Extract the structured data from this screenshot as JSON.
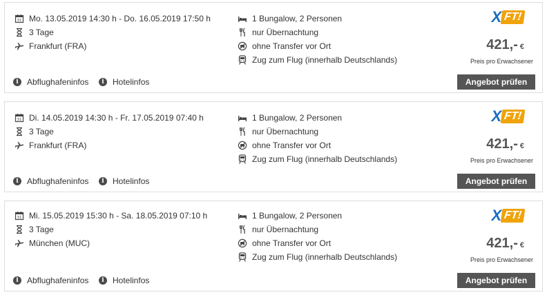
{
  "brand": {
    "logo_letter": "X",
    "logo_box": "FT!",
    "logo_x_color": "#1a6fc0",
    "logo_box_color": "#f0a30a"
  },
  "offers": [
    {
      "dates": "Mo. 13.05.2019 14:30 h - Do. 16.05.2019 17:50 h",
      "duration": "3 Tage",
      "airport": "Frankfurt (FRA)",
      "room": "1 Bungalow, 2 Personen",
      "board": "nur Übernachtung",
      "transfer": "ohne Transfer vor Ort",
      "train": "Zug zum Flug (innerhalb Deutschlands)",
      "price": "421,-",
      "currency": "€",
      "price_note": "Preis pro Erwachsener",
      "airport_info": "Abflughafeninfos",
      "hotel_info": "Hotelinfos",
      "cta": "Angebot prüfen"
    },
    {
      "dates": "Di. 14.05.2019 14:30 h - Fr. 17.05.2019 07:40 h",
      "duration": "3 Tage",
      "airport": "Frankfurt (FRA)",
      "room": "1 Bungalow, 2 Personen",
      "board": "nur Übernachtung",
      "transfer": "ohne Transfer vor Ort",
      "train": "Zug zum Flug (innerhalb Deutschlands)",
      "price": "421,-",
      "currency": "€",
      "price_note": "Preis pro Erwachsener",
      "airport_info": "Abflughafeninfos",
      "hotel_info": "Hotelinfos",
      "cta": "Angebot prüfen"
    },
    {
      "dates": "Mi. 15.05.2019 15:30 h - Sa. 18.05.2019 07:10 h",
      "duration": "3 Tage",
      "airport": "München (MUC)",
      "room": "1 Bungalow, 2 Personen",
      "board": "nur Übernachtung",
      "transfer": "ohne Transfer vor Ort",
      "train": "Zug zum Flug (innerhalb Deutschlands)",
      "price": "421,-",
      "currency": "€",
      "price_note": "Preis pro Erwachsener",
      "airport_info": "Abflughafeninfos",
      "hotel_info": "Hotelinfos",
      "cta": "Angebot prüfen"
    }
  ]
}
